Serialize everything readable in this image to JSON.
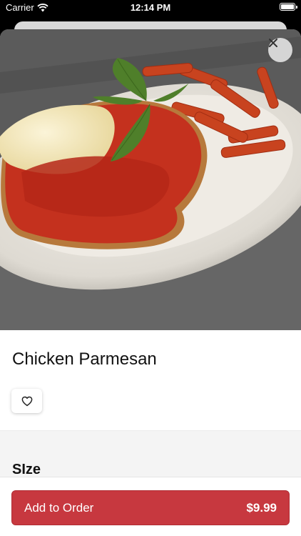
{
  "status_bar": {
    "carrier": "Carrier",
    "time": "12:14 PM",
    "wifi_icon": "wifi-icon",
    "battery_icon": "battery-icon"
  },
  "hero": {
    "image_icon": "food-photo",
    "close_icon": "close-icon"
  },
  "item": {
    "title": "Chicken Parmesan",
    "favorite_icon": "heart-icon"
  },
  "options": {
    "size_label": "SIze"
  },
  "order": {
    "button_label": "Add to Order",
    "price": "$9.99"
  },
  "colors": {
    "accent": "#c7383f"
  }
}
